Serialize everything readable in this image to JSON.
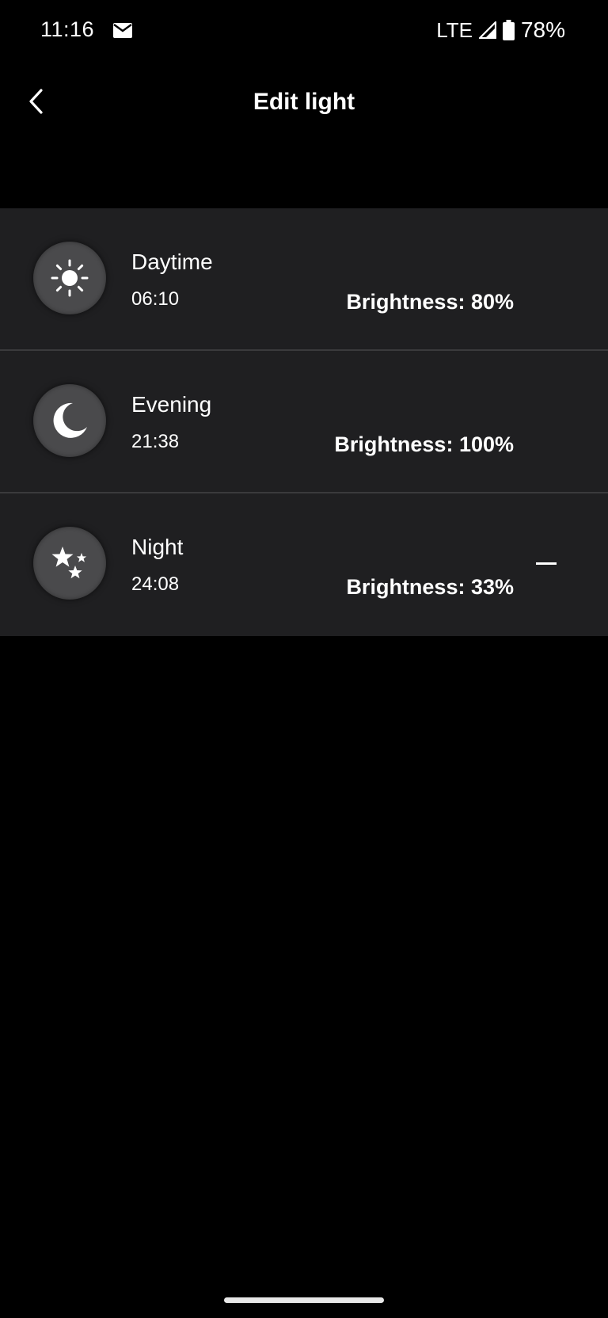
{
  "status_bar": {
    "time": "11:16",
    "network": "LTE",
    "battery": "78%"
  },
  "header": {
    "title": "Edit light"
  },
  "lights": [
    {
      "name": "Daytime",
      "time": "06:10",
      "brightness": "Brightness: 80%",
      "icon": "sun-icon"
    },
    {
      "name": "Evening",
      "time": "21:38",
      "brightness": "Brightness: 100%",
      "icon": "moon-icon"
    },
    {
      "name": "Night",
      "time": "24:08",
      "brightness": "Brightness: 33%",
      "icon": "stars-icon"
    }
  ],
  "colors": {
    "background": "#000000",
    "row_background": "#1f1f21",
    "icon_circle": "#4a4a4c",
    "divider": "#3a3a3c",
    "text": "#ffffff"
  }
}
